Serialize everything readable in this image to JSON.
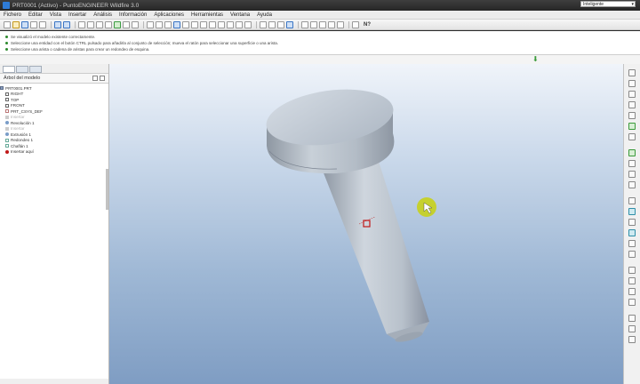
{
  "window": {
    "title": "PRT0001 (Activo) - PuntoENGINEER Wildfire 3.0"
  },
  "menu": [
    "Fichero",
    "Editar",
    "Vista",
    "Insertar",
    "Análisis",
    "Información",
    "Aplicaciones",
    "Herramientas",
    "Ventana",
    "Ayuda"
  ],
  "toolbar": {
    "end_label": "N?"
  },
  "messages": [
    "Se visualizó el modelo existente correctamente.",
    "Seleccione una entidad con el botón CTRL pulsado para añadirla al conjunto de selección; mueva el ratón para seleccionar una superficie o una arista.",
    "Seleccione una arista o cadena de aristas para crear un redondeo de esquina."
  ],
  "filter": {
    "value": "Inteligente"
  },
  "model_tree": {
    "header": "Árbol del modelo",
    "items": [
      {
        "label": "PRT0001.PRT",
        "icon": "part-icon",
        "dim": false
      },
      {
        "label": "RIGHT",
        "icon": "datum-plane-icon",
        "dim": false
      },
      {
        "label": "TOP",
        "icon": "datum-plane-icon",
        "dim": false
      },
      {
        "label": "FRONT",
        "icon": "datum-plane-icon",
        "dim": false
      },
      {
        "label": "PRT_CSYS_DEF",
        "icon": "csys-icon",
        "dim": false
      },
      {
        "label": "Insertar",
        "icon": "grey-icon",
        "dim": true
      },
      {
        "label": "Revolución 1",
        "icon": "revolve-icon",
        "dim": false
      },
      {
        "label": "Insertar",
        "icon": "grey-icon",
        "dim": true
      },
      {
        "label": "Extrusión 1",
        "icon": "extrude-icon",
        "dim": false
      },
      {
        "label": "Redondeo 1",
        "icon": "round-icon",
        "dim": false
      },
      {
        "label": "Chaflán 1",
        "icon": "chamfer-icon",
        "dim": false
      },
      {
        "label": "Insertar aquí",
        "icon": "insert-here-icon",
        "dim": false
      }
    ]
  },
  "colors": {
    "viewport_top": "#f0f4fa",
    "viewport_bottom": "#7f9dc3",
    "model": "#b9c2cc",
    "cursor": "#c8d10f",
    "selection": "#c01818"
  }
}
